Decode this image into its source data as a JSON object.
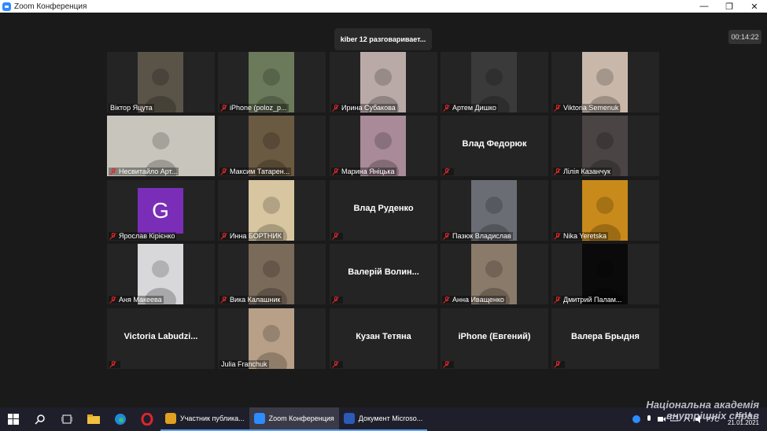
{
  "window": {
    "title": "Zoom Конференция"
  },
  "meeting": {
    "speaker_banner": "kiber 12 разговаривает...",
    "elapsed": "00:14:22"
  },
  "participants": [
    {
      "name": "Віктор Яцута",
      "video": true,
      "muted": false,
      "bg": "#5a5448"
    },
    {
      "name": "iPhone (poloz_p...",
      "video": true,
      "muted": true,
      "bg": "#6b7a5a"
    },
    {
      "name": "Ирина Субакова",
      "video": true,
      "muted": true,
      "bg": "#b9aaa8"
    },
    {
      "name": "Артем Дишко",
      "video": true,
      "muted": true,
      "bg": "#3a3a3a"
    },
    {
      "name": "Viktoria Semenuk",
      "video": true,
      "muted": true,
      "bg": "#c9b8aa"
    },
    {
      "name": "Несвитайло Арт...",
      "video": true,
      "muted": true,
      "bg": "#c8c6bc",
      "wide": true
    },
    {
      "name": "Максим Татарен...",
      "video": true,
      "muted": true,
      "bg": "#6b5a42"
    },
    {
      "name": "Марина Яніцька",
      "video": true,
      "muted": true,
      "bg": "#a88a98"
    },
    {
      "name": "Влад Федорюк",
      "video": false,
      "muted": true
    },
    {
      "name": "Лілія Казанчук",
      "video": true,
      "muted": true,
      "bg": "#4a4444"
    },
    {
      "name": "Ярослав Кірієнко",
      "video": false,
      "muted": true,
      "avatar": "G"
    },
    {
      "name": "Инна БОРТНИК",
      "video": true,
      "muted": true,
      "bg": "#d8c6a0"
    },
    {
      "name": "Влад Руденко",
      "video": false,
      "muted": true
    },
    {
      "name": "Пазюк Владислав",
      "video": true,
      "muted": true,
      "bg": "#6a6e74"
    },
    {
      "name": "Nika Yeretska",
      "video": true,
      "muted": true,
      "bg": "#c88a1a"
    },
    {
      "name": "Аня Макеева",
      "video": true,
      "muted": true,
      "bg": "#d8d8da"
    },
    {
      "name": "Вика Калашник",
      "video": true,
      "muted": true,
      "bg": "#7a6a5a"
    },
    {
      "name": "Валерій Волин...",
      "video": false,
      "muted": true
    },
    {
      "name": "Анна Иващенко",
      "video": true,
      "muted": true,
      "bg": "#8a7a6a"
    },
    {
      "name": "Дмитрий Палам...",
      "video": true,
      "muted": true,
      "bg": "#0a0a0a"
    },
    {
      "name": "Victoria Labudzi...",
      "video": false,
      "muted": true
    },
    {
      "name": "Julia Franchuk",
      "video": true,
      "muted": false,
      "bg": "#b8a088"
    },
    {
      "name": "Кузан Тетяна",
      "video": false,
      "muted": true
    },
    {
      "name": "iPhone (Евгений)",
      "video": false,
      "muted": true
    },
    {
      "name": "Валера Брыдня",
      "video": false,
      "muted": true
    }
  ],
  "taskbar": {
    "apps": [
      {
        "label": "Участник публика...",
        "color": "#e0a020"
      },
      {
        "label": "Zoom Конференция",
        "color": "#2d8cff",
        "active": true
      },
      {
        "label": "Документ Microso...",
        "color": "#2b5ab8"
      }
    ],
    "lang": "РУС",
    "time": "15:14",
    "date": "21.01.2021"
  },
  "watermark": {
    "line1": "Національна академія",
    "line2": "внутрішніх справ"
  }
}
